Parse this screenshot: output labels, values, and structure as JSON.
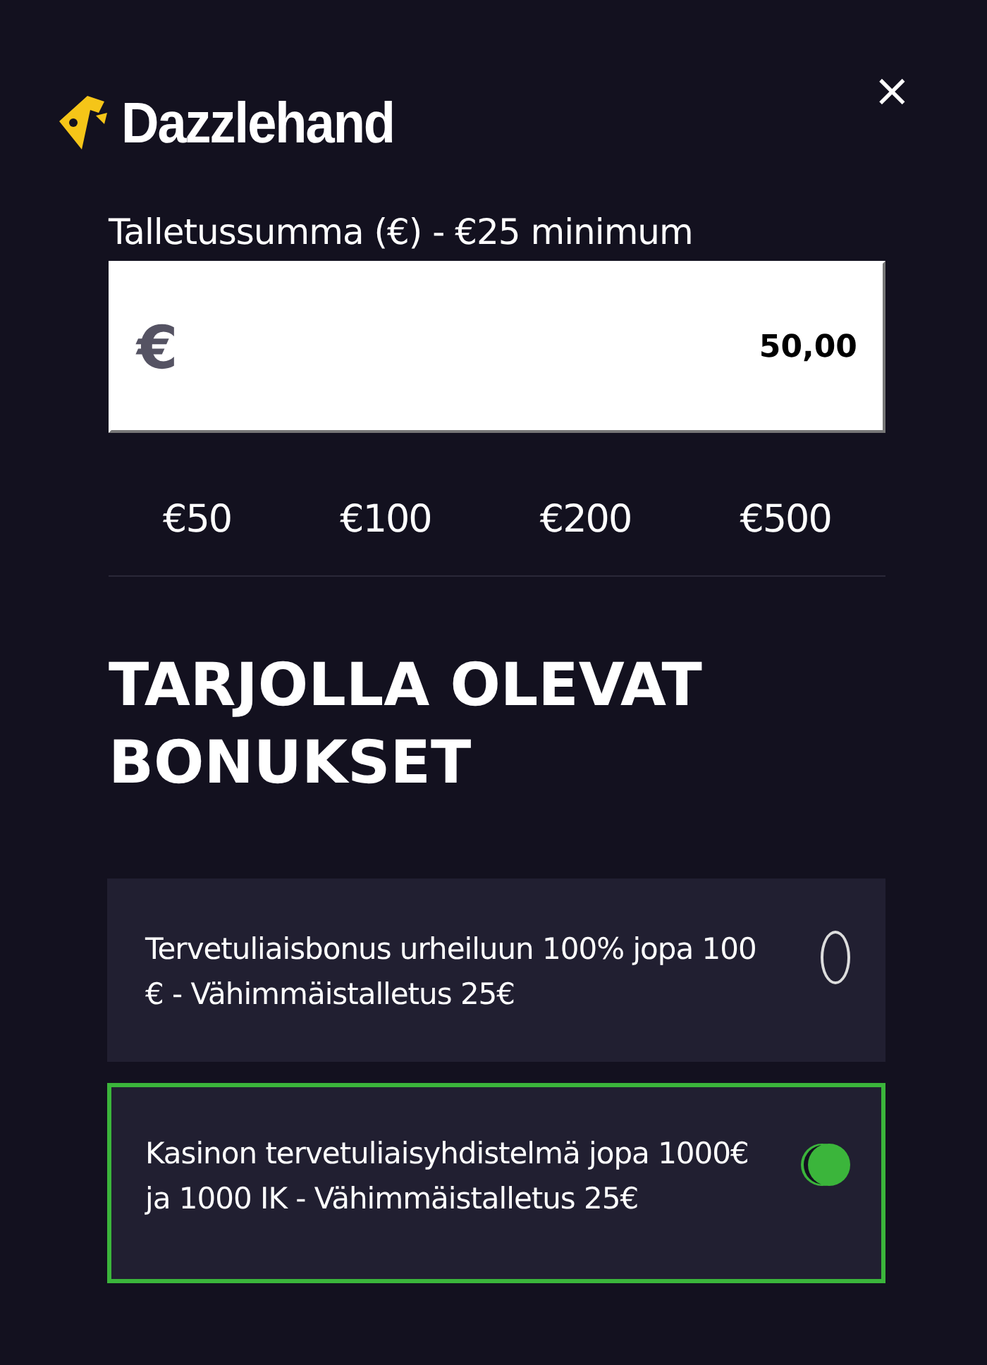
{
  "close_button": "×",
  "logo": {
    "text": "Dazzlehand"
  },
  "deposit": {
    "label": "Talletussumma (€) - €25 minimum",
    "currency": "€",
    "value": "50,00"
  },
  "quick_amounts": [
    {
      "label": "€50"
    },
    {
      "label": "€100"
    },
    {
      "label": "€200"
    },
    {
      "label": "€500"
    }
  ],
  "bonuses": {
    "title": "TARJOLLA OLEVAT BONUKSET",
    "items": [
      {
        "text": "Tervetuliaisbonus urheiluun 100% jopa 100 € - Vähimmäistalletus 25€",
        "selected": false
      },
      {
        "text": "Kasinon tervetuliaisyhdistelmä jopa 1000€ ja 1000 IK - Vähimmäistalletus 25€",
        "selected": true
      }
    ]
  }
}
